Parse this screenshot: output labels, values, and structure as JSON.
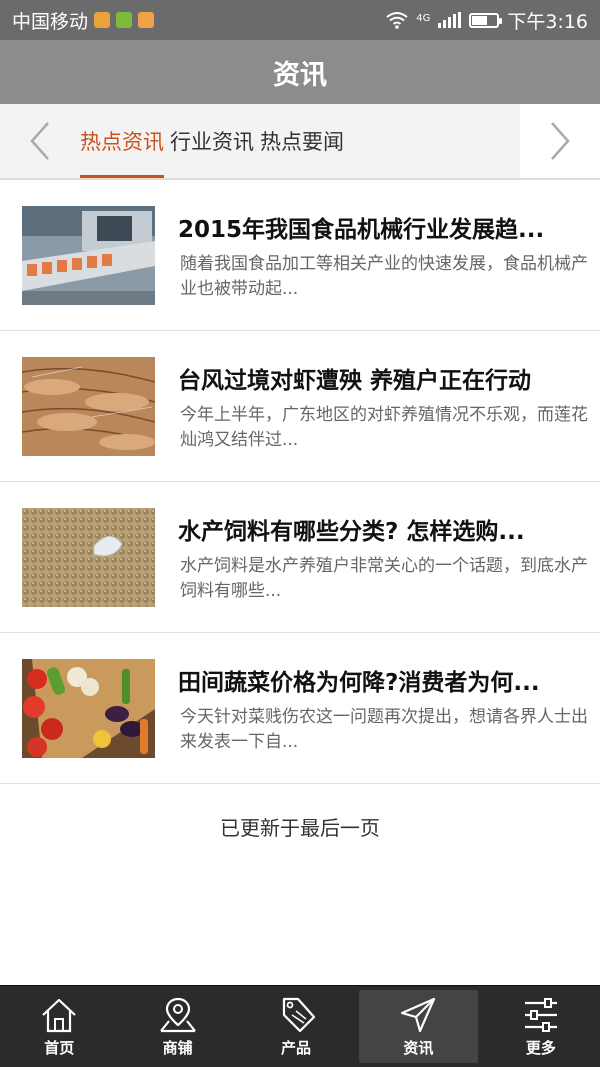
{
  "status": {
    "carrier": "中国移动",
    "network": "4G",
    "time": "下午3:16"
  },
  "header": {
    "title": "资讯"
  },
  "tabs": [
    {
      "label": "热点资讯",
      "active": true
    },
    {
      "label": "行业资讯",
      "active": false
    },
    {
      "label": "热点要闻",
      "active": false
    }
  ],
  "articles": [
    {
      "title": "2015年我国食品机械行业发展趋...",
      "desc": "随着我国食品加工等相关产业的快速发展，食品机械产业也被带动起..."
    },
    {
      "title": "台风过境对虾遭殃 养殖户正在行动",
      "desc": "今年上半年，广东地区的对虾养殖情况不乐观，而莲花灿鸿又结伴过..."
    },
    {
      "title": "水产饲料有哪些分类? 怎样选购...",
      "desc": " 水产饲料是水产养殖户非常关心的一个话题，到底水产饲料有哪些..."
    },
    {
      "title": "田间蔬菜价格为何降?消费者为何...",
      "desc": "今天针对菜贱伤农这一问题再次提出，想请各界人士出来发表一下自..."
    }
  ],
  "end_note": "已更新于最后一页",
  "nav": [
    {
      "label": "首页",
      "icon": "home-icon"
    },
    {
      "label": "商铺",
      "icon": "shop-map-icon"
    },
    {
      "label": "产品",
      "icon": "sale-tag-icon"
    },
    {
      "label": "资讯",
      "icon": "paper-plane-icon",
      "active": true
    },
    {
      "label": "更多",
      "icon": "sliders-icon"
    }
  ],
  "colors": {
    "accent": "#c9521b",
    "titlebar": "#8c8c8c",
    "navbar": "#2b2b2b"
  }
}
